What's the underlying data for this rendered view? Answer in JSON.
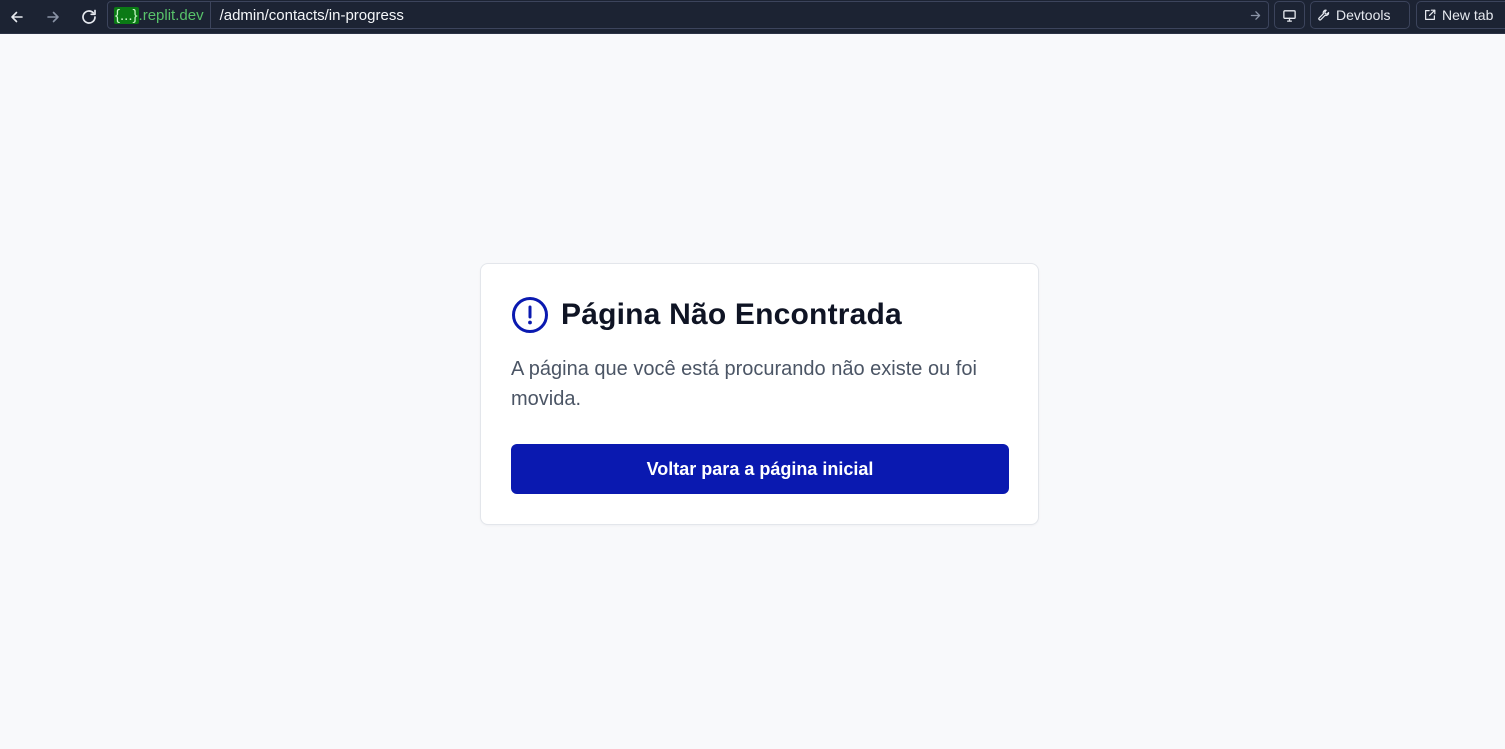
{
  "browser": {
    "url_host_braces": "{...}",
    "url_host_suffix": ".replit.dev",
    "url_path": "/admin/contacts/in-progress",
    "devtools_label": "Devtools",
    "new_tab_label": "New tab",
    "icons": {
      "back": "arrow-left-icon",
      "forward": "arrow-right-icon",
      "reload": "reload-icon",
      "go": "arrow-right-icon",
      "screen": "monitor-icon",
      "devtools": "wrench-icon",
      "new_tab": "external-link-icon"
    }
  },
  "page": {
    "title": "Página Não Encontrada",
    "description": "A página que você está procurando não existe ou foi movida.",
    "button_label": "Voltar para a página inicial",
    "icon": "alert-circle-icon"
  },
  "colors": {
    "accent": "#0a19b0",
    "title": "#0f1424",
    "text": "#4b5565",
    "background": "#f8f9fb",
    "chrome": "#1c2333",
    "host_green": "#58c26a"
  }
}
